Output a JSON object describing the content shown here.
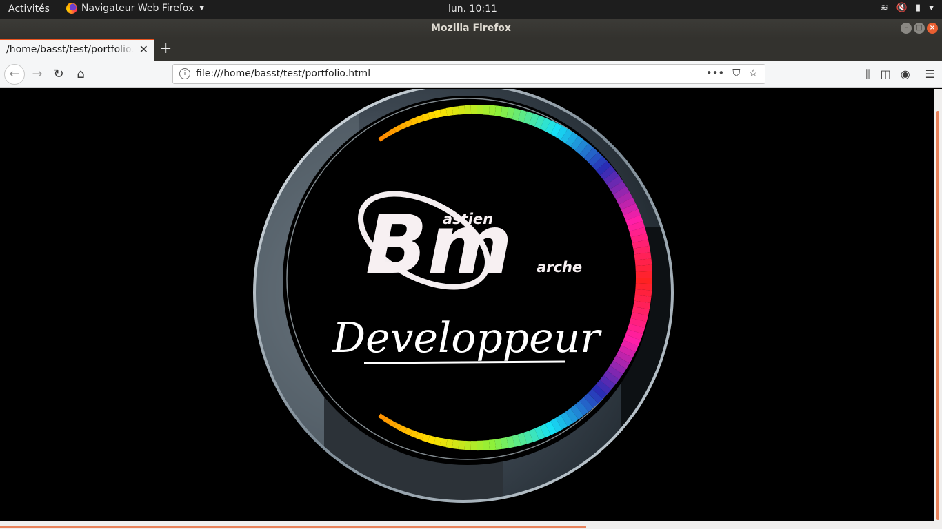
{
  "topbar": {
    "activities": "Activités",
    "app_menu": "Navigateur Web Firefox",
    "clock": "lun. 10:11"
  },
  "window": {
    "title": "Mozilla Firefox"
  },
  "tabs": [
    {
      "label": "/home/basst/test/portfolio.html"
    }
  ],
  "navbar": {
    "url": "file:///home/basst/test/portfolio.html"
  },
  "logo": {
    "big_letters": "Bm",
    "first_name_rest": "astien",
    "last_name_rest": "arche",
    "subtitle": "Developpeur"
  },
  "colors": {
    "accent": "#e95420",
    "ring_gradient": [
      "#ff2222",
      "#ff1fa8",
      "#2a2db5",
      "#17e0f5",
      "#8ef03a",
      "#ffe000",
      "#ff8a00"
    ]
  }
}
